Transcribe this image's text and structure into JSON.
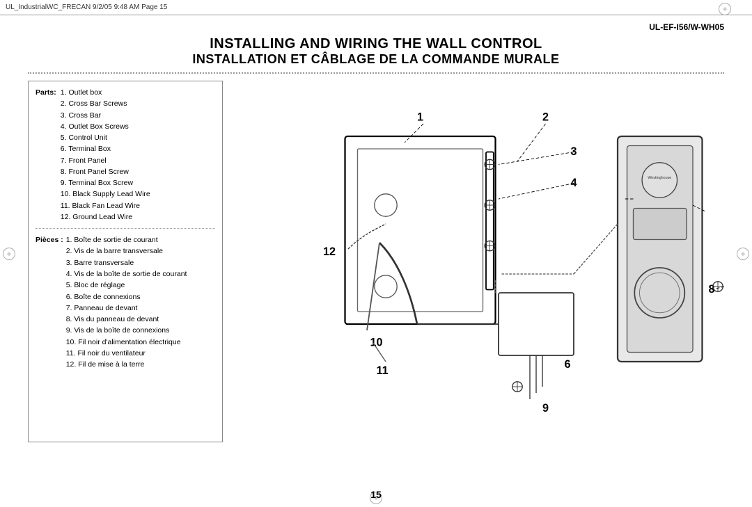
{
  "header": {
    "text": "UL_IndustrialWC_FRECAN   9/2/05   9:48 AM   Page 15"
  },
  "model": "UL-EF-I56/W-WH05",
  "title": {
    "line1": "INSTALLING AND WIRING THE WALL CONTROL",
    "line2": "INSTALLATION ET CÂBLAGE DE LA COMMANDE MURALE"
  },
  "parts_label": "Parts:",
  "parts_english": [
    "1. Outlet box",
    "2. Cross Bar Screws",
    "3. Cross Bar",
    "4. Outlet Box Screws",
    "5. Control Unit",
    "6. Terminal Box",
    "7. Front Panel",
    "8. Front Panel Screw",
    "9. Terminal Box Screw",
    "10. Black Supply Lead Wire",
    "11. Black Fan Lead Wire",
    "12. Ground Lead Wire"
  ],
  "pieces_label": "Pièces :",
  "parts_french": [
    "1. Boîte de sortie de courant",
    "2. Vis de la barre transversale",
    "3. Barre transversale",
    "4. Vis de la boîte de sortie de courant",
    "5. Bloc de réglage",
    "6. Boîte de connexions",
    "7. Panneau de devant",
    "8. Vis du panneau de devant",
    "9. Vis de la boîte de connexions",
    "10. Fil noir d'alimentation électrique",
    "11. Fil noir du ventilateur",
    "12. Fil de mise à la terre"
  ],
  "page_number": "15"
}
